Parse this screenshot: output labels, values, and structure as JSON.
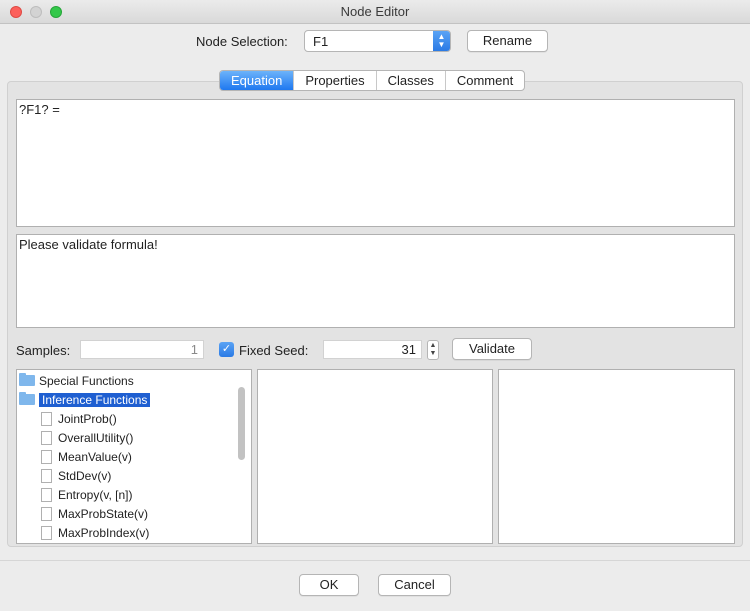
{
  "window": {
    "title": "Node Editor"
  },
  "header": {
    "node_selection_label": "Node Selection:",
    "node_selection_value": "F1",
    "rename_label": "Rename"
  },
  "tabs": [
    {
      "label": "Equation",
      "active": true
    },
    {
      "label": "Properties",
      "active": false
    },
    {
      "label": "Classes",
      "active": false
    },
    {
      "label": "Comment",
      "active": false
    }
  ],
  "equation": {
    "text": "?F1? ="
  },
  "validation": {
    "message": "Please validate formula!"
  },
  "controls": {
    "samples_label": "Samples:",
    "samples_value": "1",
    "fixed_seed_label": "Fixed Seed:",
    "fixed_seed_checked": true,
    "seed_value": "31",
    "validate_label": "Validate"
  },
  "function_tree": {
    "folders": [
      {
        "label": "Special Functions",
        "expanded": false
      },
      {
        "label": "Inference Functions",
        "expanded": true,
        "selected": true
      }
    ],
    "items": [
      "JointProb()",
      "OverallUtility()",
      "MeanValue(v)",
      "StdDev(v)",
      "Entropy(v, [n])",
      "MaxProbState(v)",
      "MaxProbIndex(v)"
    ]
  },
  "footer": {
    "ok_label": "OK",
    "cancel_label": "Cancel"
  },
  "colors": {
    "accent": "#2a7ae5",
    "selection": "#1f5fd1"
  }
}
